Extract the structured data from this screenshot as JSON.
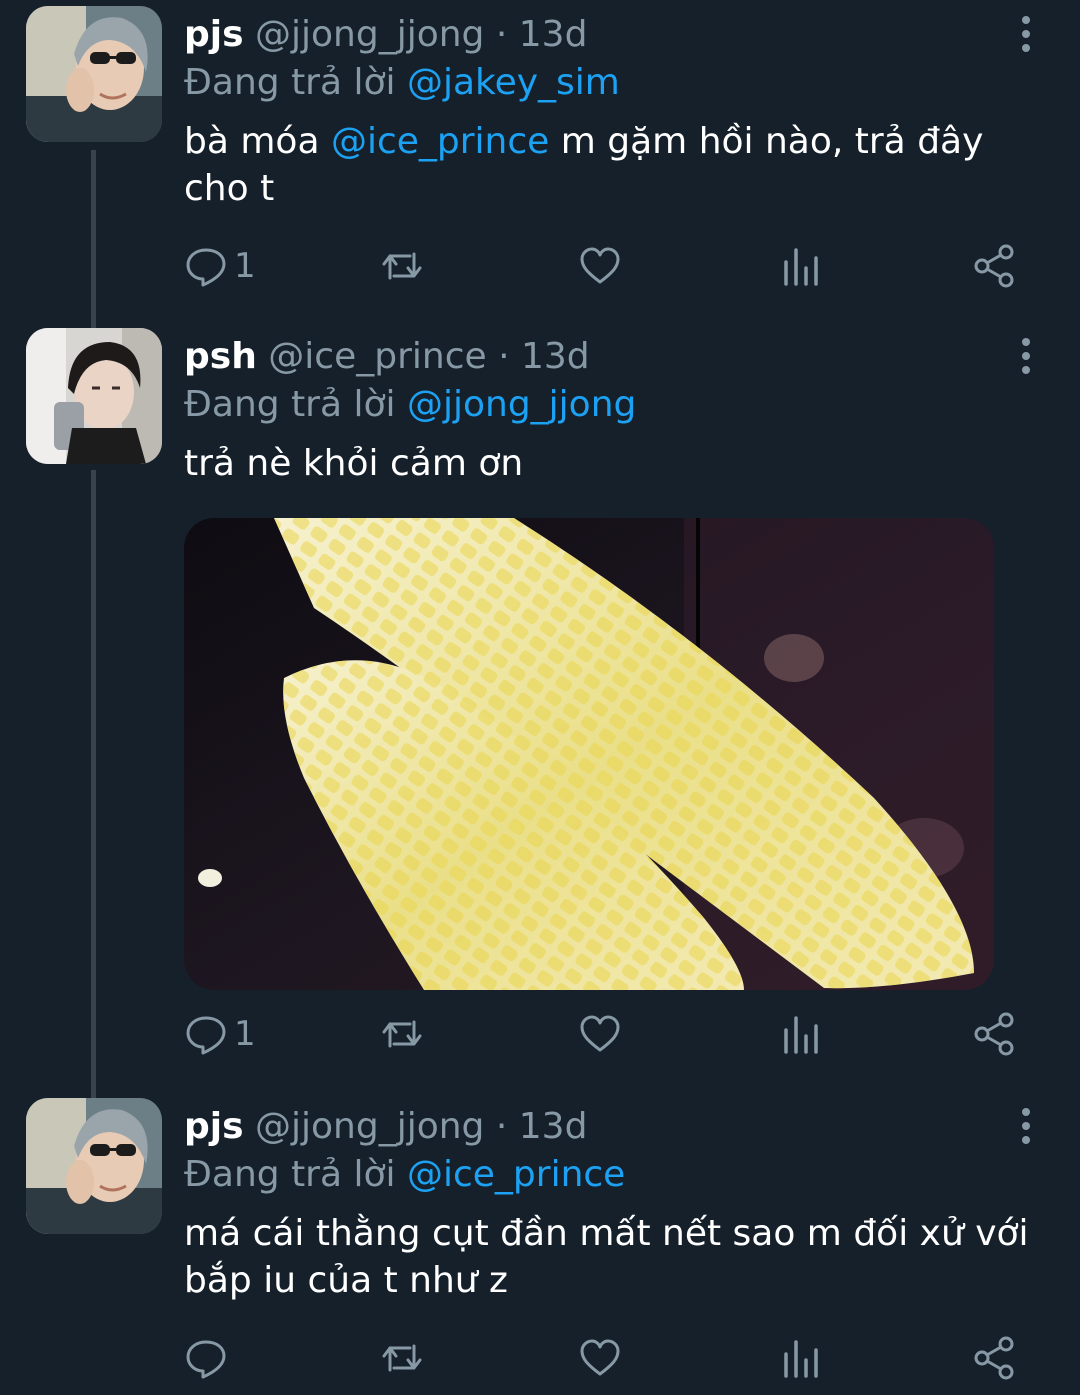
{
  "tweets": [
    {
      "name": "pjs",
      "handle": "@jjong_jjong",
      "sep": "·",
      "time": "13d",
      "replying_prefix": "Đang trả lời ",
      "replying_to": "@jakey_sim",
      "text_before": "bà móa ",
      "text_mention": "@ice_prince",
      "text_after": " m gặm hồi nào, trả đây cho t",
      "reply_count": "1"
    },
    {
      "name": "psh",
      "handle": "@ice_prince",
      "sep": "·",
      "time": "13d",
      "replying_prefix": "Đang trả lời ",
      "replying_to": "@jjong_jjong",
      "text": "trả nè khỏi cảm ơn",
      "reply_count": "1"
    },
    {
      "name": "pjs",
      "handle": "@jjong_jjong",
      "sep": "·",
      "time": "13d",
      "replying_prefix": "Đang trả lời ",
      "replying_to": "@ice_prince",
      "text": "má cái thằng cụt đần mất nết sao m đối xử với bắp iu của t như z",
      "reply_count": ""
    }
  ],
  "icons": [
    "reply-icon",
    "retweet-icon",
    "like-icon",
    "stats-icon",
    "share-icon",
    "more-icon"
  ],
  "colors": {
    "background": "#15202b",
    "text": "#ffffff",
    "muted": "#8899a6",
    "link": "#1da1f2",
    "thread": "#38444d"
  }
}
